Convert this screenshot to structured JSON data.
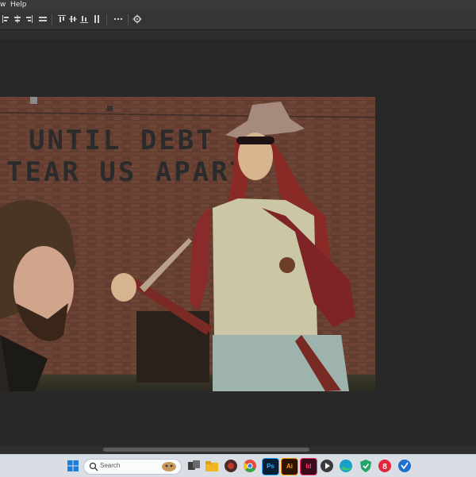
{
  "menu": {
    "items": [
      {
        "label": "w"
      },
      {
        "label": "Help"
      }
    ]
  },
  "options_bar": {
    "align_icons": [
      "align-left-icon",
      "align-hcenter-icon",
      "align-right-icon",
      "distribute-icon",
      "align-top-icon",
      "align-vcenter-icon",
      "align-bottom-icon",
      "distribute-vertical-icon"
    ],
    "more_icon": "more-icon",
    "settings_icon": "gear-icon"
  },
  "canvas": {
    "poster_line1": "UNTIL DEBT",
    "poster_line2": "TEAR US APART"
  },
  "taskbar": {
    "search_placeholder": "Search",
    "apps": [
      "windows-start-icon",
      "file-explorer-icon",
      "mail-icon",
      "chrome-icon",
      "photoshop-icon",
      "illustrator-icon",
      "indesign-icon",
      "media-player-icon",
      "edge-icon",
      "security-icon",
      "app-icon",
      "vpn-icon"
    ],
    "ps_label": "Ps",
    "ai_label": "Ai",
    "id_label": "Id"
  }
}
